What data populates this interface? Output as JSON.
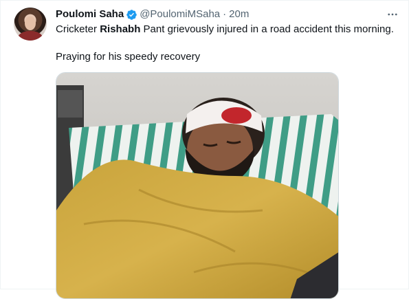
{
  "tweet": {
    "display_name": "Poulomi Saha",
    "handle": "@PoulomiMSaha",
    "separator": "·",
    "time": "20m",
    "verified": true,
    "line1_before": "Cricketer ",
    "line1_bold": "Rishabh",
    "line1_after": " Pant grievously injured in a road accident this morning.",
    "line2": "Praying for his speedy recovery",
    "more_icon": "more-horizontal-icon",
    "media_alt": "photo"
  },
  "colors": {
    "verified_blue": "#1d9bf0",
    "secondary_text": "#536471",
    "primary_text": "#0f1419"
  }
}
